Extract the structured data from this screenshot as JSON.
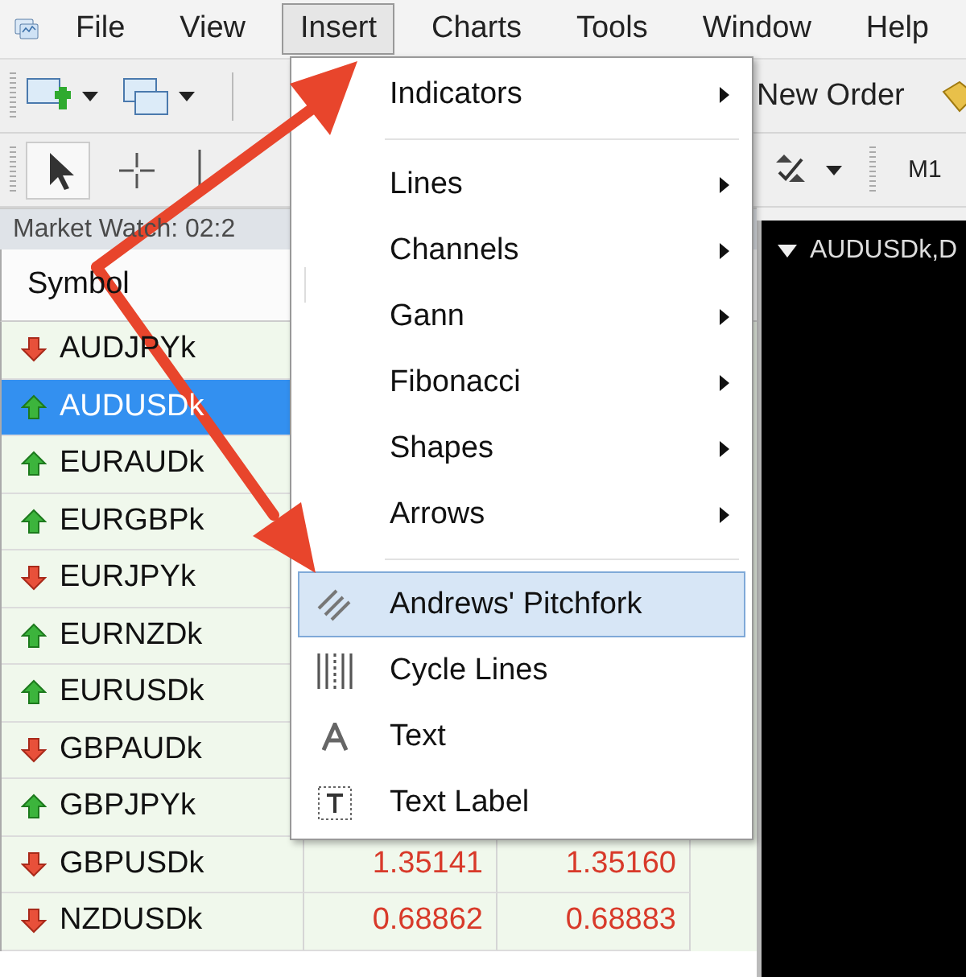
{
  "menu_bar": [
    {
      "label": "File",
      "selected": false
    },
    {
      "label": "View",
      "selected": false
    },
    {
      "label": "Insert",
      "selected": true
    },
    {
      "label": "Charts",
      "selected": false
    },
    {
      "label": "Tools",
      "selected": false
    },
    {
      "label": "Window",
      "selected": false
    },
    {
      "label": "Help",
      "selected": false
    }
  ],
  "toolbar": {
    "new_order": "New Order",
    "timeframe": "M1"
  },
  "market_watch": {
    "title": "Market Watch: 02:2",
    "columns": [
      "Symbol"
    ],
    "rows": [
      {
        "symbol": "AUDJPYk",
        "rising": false,
        "selected": false
      },
      {
        "symbol": "AUDUSDk",
        "rising": true,
        "selected": true
      },
      {
        "symbol": "EURAUDk",
        "rising": true,
        "selected": false
      },
      {
        "symbol": "EURGBPk",
        "rising": true,
        "selected": false
      },
      {
        "symbol": "EURJPYk",
        "rising": false,
        "selected": false
      },
      {
        "symbol": "EURNZDk",
        "rising": true,
        "selected": false
      },
      {
        "symbol": "EURUSDk",
        "rising": true,
        "selected": false
      },
      {
        "symbol": "GBPAUDk",
        "rising": false,
        "selected": false
      },
      {
        "symbol": "GBPJPYk",
        "rising": true,
        "selected": false
      },
      {
        "symbol": "GBPUSDk",
        "rising": false,
        "selected": false,
        "bid": "1.35141",
        "ask": "1.35160"
      },
      {
        "symbol": "NZDUSDk",
        "rising": false,
        "selected": false,
        "bid": "0.68862",
        "ask": "0.68883"
      }
    ]
  },
  "chart": {
    "title": "AUDUSDk,D"
  },
  "insert_menu": [
    {
      "kind": "submenu",
      "label": "Indicators",
      "selected": false
    },
    {
      "kind": "separator"
    },
    {
      "kind": "submenu",
      "label": "Lines",
      "selected": false
    },
    {
      "kind": "submenu",
      "label": "Channels",
      "selected": false
    },
    {
      "kind": "submenu",
      "label": "Gann",
      "selected": false
    },
    {
      "kind": "submenu",
      "label": "Fibonacci",
      "selected": false
    },
    {
      "kind": "submenu",
      "label": "Shapes",
      "selected": false
    },
    {
      "kind": "submenu",
      "label": "Arrows",
      "selected": false
    },
    {
      "kind": "separator"
    },
    {
      "kind": "pitchfork",
      "label": "Andrews' Pitchfork",
      "selected": true
    },
    {
      "kind": "cycle",
      "label": "Cycle Lines",
      "selected": false
    },
    {
      "kind": "text",
      "label": "Text",
      "selected": false
    },
    {
      "kind": "textlabel",
      "label": "Text Label",
      "selected": false
    }
  ]
}
